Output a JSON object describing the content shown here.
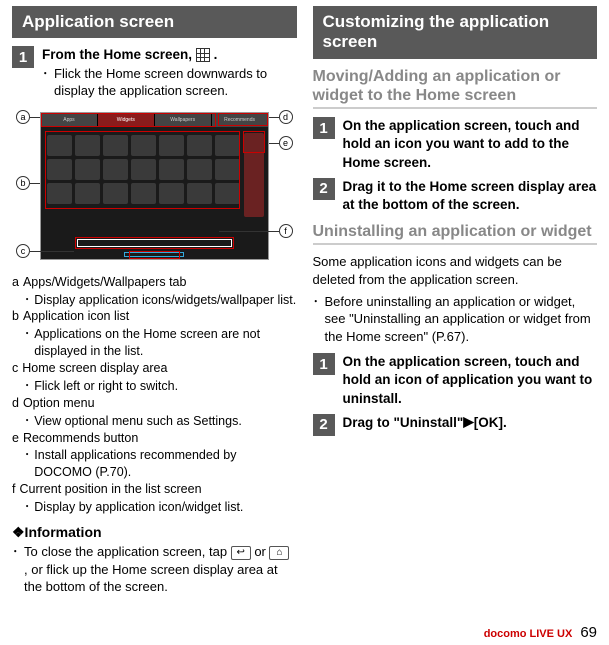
{
  "left": {
    "header": "Application screen",
    "step1": {
      "num": "1",
      "title_a": "From the Home screen, ",
      "title_b": ".",
      "bullet": "Flick the Home screen downwards to display the application screen."
    },
    "tabs": {
      "apps": "Apps",
      "widgets": "Widgets",
      "wallpapers": "Wallpapers",
      "recommends": "Recommends"
    },
    "marks": {
      "a": "a",
      "b": "b",
      "c": "c",
      "d": "d",
      "e": "e",
      "f": "f"
    },
    "defs": [
      {
        "label": "a",
        "text": "Apps/Widgets/Wallpapers tab",
        "sub": "Display application icons/widgets/wallpaper list."
      },
      {
        "label": "b",
        "text": "Application icon list",
        "sub": "Applications on the Home screen are not displayed in the list."
      },
      {
        "label": "c",
        "text": "Home screen display area",
        "sub": "Flick left or right to switch."
      },
      {
        "label": "d",
        "text": "Option menu",
        "sub": "View optional menu such as Settings."
      },
      {
        "label": "e",
        "text": "Recommends button",
        "sub": "Install applications recommended by DOCOMO (P.70)."
      },
      {
        "label": "f",
        "text": "Current position in the list screen",
        "sub": "Display by application icon/widget list."
      }
    ],
    "info_head": "❖Information",
    "info_body_a": "To close the application screen, tap ",
    "info_body_b": " or ",
    "info_body_c": " , or flick up the Home screen display area at the bottom of the screen.",
    "key_back": "↩",
    "key_home": "⌂"
  },
  "right": {
    "header": "Customizing the application screen",
    "sub1": "Moving/Adding an application or widget to the Home screen",
    "step1": {
      "num": "1",
      "text": "On the application screen, touch and hold an icon you want to add to the Home screen."
    },
    "step2": {
      "num": "2",
      "text": "Drag it to the Home screen display area at the bottom of the screen."
    },
    "sub2": "Uninstalling an application or widget",
    "intro1": "Some application icons and widgets can be deleted from the application screen.",
    "intro2": "Before uninstalling an application or widget, see \"Uninstalling an application or widget from the Home screen\" (P.67).",
    "step3": {
      "num": "1",
      "text": "On the application screen, touch and hold an icon of application you want to uninstall."
    },
    "step4": {
      "num": "2",
      "text_a": "Drag to \"Uninstall\"",
      "text_b": "[OK]."
    }
  },
  "footer": {
    "brand": "docomo LIVE UX",
    "page": "69"
  }
}
